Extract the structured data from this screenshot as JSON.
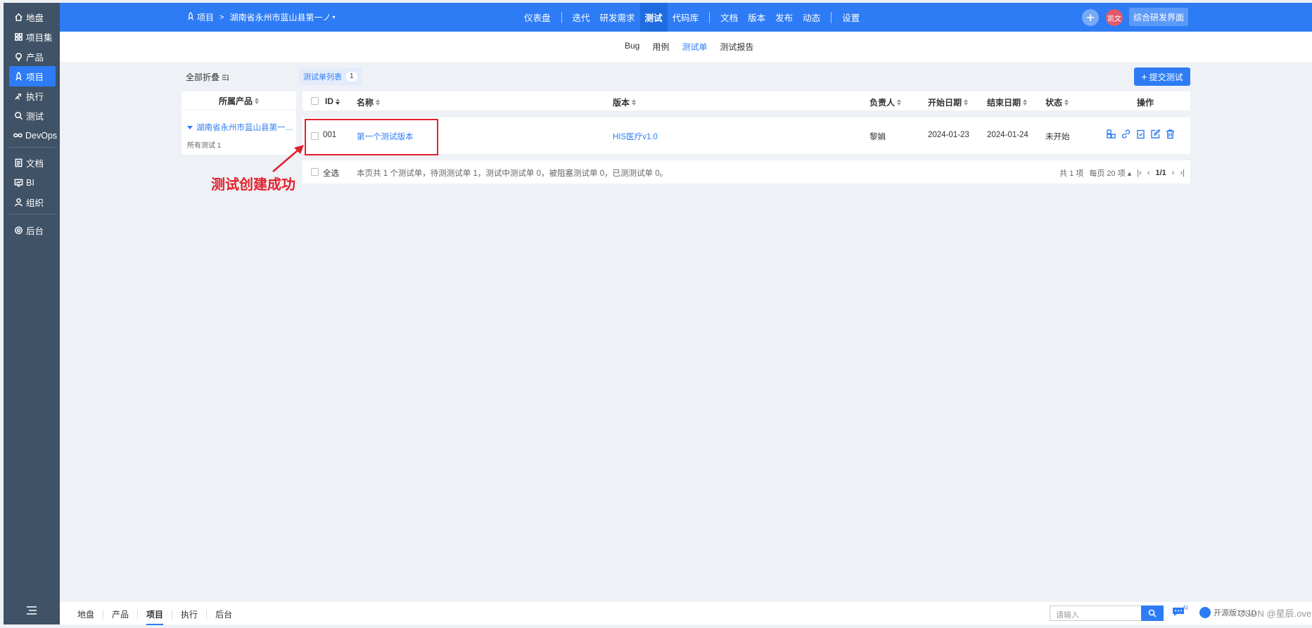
{
  "leftnav": {
    "items": [
      {
        "label": "地盘",
        "icon": "home-icon"
      },
      {
        "label": "项目集",
        "icon": "grid-icon"
      },
      {
        "label": "产品",
        "icon": "bulb-icon"
      },
      {
        "label": "项目",
        "icon": "rocket-icon"
      },
      {
        "label": "执行",
        "icon": "run-icon"
      },
      {
        "label": "测试",
        "icon": "search-icon"
      },
      {
        "label": "DevOps",
        "icon": "infinity-icon"
      },
      {
        "label": "文档",
        "icon": "doc-icon"
      },
      {
        "label": "BI",
        "icon": "chart-icon"
      },
      {
        "label": "组织",
        "icon": "people-icon"
      },
      {
        "label": "后台",
        "icon": "gear-icon"
      }
    ]
  },
  "header": {
    "crumb_root": "项目",
    "crumb_project": "湖南省永州市蓝山县第一ノ",
    "nav": [
      "仪表盘",
      "迭代",
      "研发需求",
      "测试",
      "代码库",
      "文档",
      "版本",
      "发布",
      "动态",
      "设置"
    ],
    "avatar": "凯文",
    "switch_label": "综合研发界面"
  },
  "subnav": [
    "Bug",
    "用例",
    "测试单",
    "测试报告"
  ],
  "toolbar": {
    "collapse_label": "全部折叠",
    "tab_label": "测试单列表",
    "tab_count": "1",
    "submit_label": "提交测试"
  },
  "tree": {
    "header": "所属产品",
    "product": "湖南省永州市蓝山县第一…",
    "sub": "所有测试 1"
  },
  "table": {
    "columns": [
      "ID",
      "名称",
      "版本",
      "负责人",
      "开始日期",
      "结束日期",
      "状态",
      "操作"
    ],
    "rows": [
      {
        "id": "001",
        "name": "第一个测试版本",
        "build": "HIS医疗v1.0",
        "owner": "黎娟",
        "begin": "2024-01-23",
        "end": "2024-01-24",
        "status": "未开始"
      }
    ],
    "select_all": "全选",
    "summary": "本页共 1 个测试单，待测测试单 1，测试中测试单 0，被阻塞测试单 0，已测测试单 0。",
    "pager": {
      "total": "共 1 项",
      "per_page": "每页 20 项",
      "page": "1/1"
    }
  },
  "annotation": {
    "text": "测试创建成功",
    "color": "#e3202d"
  },
  "bottombar": {
    "items": [
      "地盘",
      "产品",
      "项目",
      "执行",
      "后台"
    ],
    "search_placeholder": "请输入",
    "ai_label": "AI",
    "version": "开源版18.10",
    "watermark": "CSDN @星辰.ove"
  },
  "colors": {
    "primary": "#2d7cf6",
    "sidebar": "#3f5266"
  }
}
